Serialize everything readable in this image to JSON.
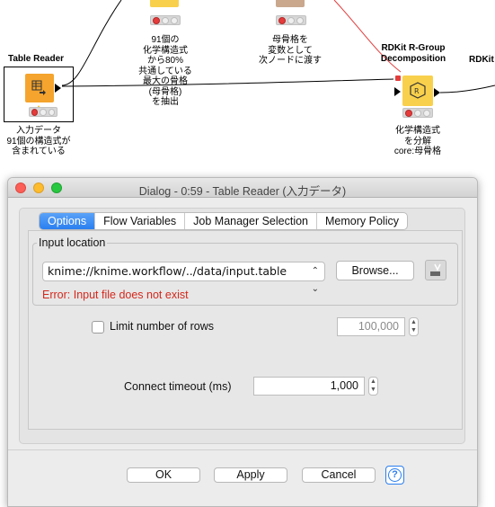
{
  "workflow": {
    "nodes": {
      "table_reader": {
        "title": "Table Reader",
        "desc": "入力データ\n91個の構造式が\n含まれている"
      },
      "top_left": {
        "desc": "91個の\n化学構造式\nから80%\n共通している\n最大の骨格\n(母骨格)\nを抽出"
      },
      "top_middle": {
        "desc": "母骨格を\n変数として\n次ノードに渡す"
      },
      "rgroup": {
        "title": "RDKit R-Group\nDecomposition",
        "desc": "化学構造式\nを分解\ncore:母骨格"
      },
      "partial": {
        "title": "RDKit"
      }
    }
  },
  "dialog": {
    "title": "Dialog - 0:59 - Table Reader (入力データ)",
    "tabs": [
      {
        "label": "Options",
        "active": true
      },
      {
        "label": "Flow Variables",
        "active": false
      },
      {
        "label": "Job Manager Selection",
        "active": false
      },
      {
        "label": "Memory Policy",
        "active": false
      }
    ],
    "input_location": {
      "legend": "Input location",
      "path": "knime://knime.workflow/../data/input.table",
      "browse_label": "Browse...",
      "error": "Error: Input file does not exist"
    },
    "limit_rows": {
      "label": "Limit number of rows",
      "checked": false,
      "value": "100,000"
    },
    "connect_timeout": {
      "label": "Connect timeout (ms)",
      "value": "1,000"
    },
    "buttons": {
      "ok": "OK",
      "apply": "Apply",
      "cancel": "Cancel",
      "help": "?"
    }
  },
  "colors": {
    "accent": "#2a7ff0",
    "error": "#d5281c",
    "node_orange": "#f5a42d",
    "node_yellow": "#f9d04c",
    "edge_red": "#e23c3c"
  }
}
